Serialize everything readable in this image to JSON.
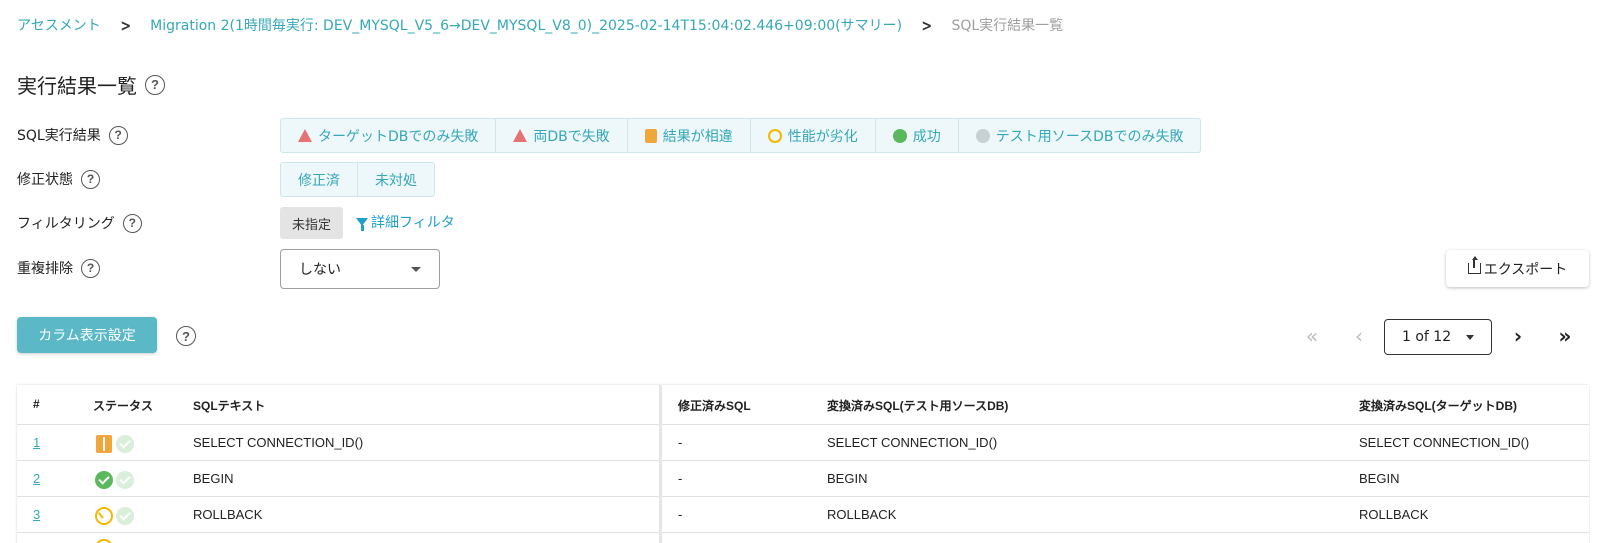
{
  "breadcrumb": {
    "items": [
      "アセスメント",
      "Migration 2(1時間毎実行: DEV_MYSQL_V5_6→DEV_MYSQL_V8_0)_2025-02-14T15:04:02.446+09:00(サマリー)"
    ],
    "current": "SQL実行結果一覧"
  },
  "page_title": "実行結果一覧",
  "filters": {
    "sql_result": {
      "label": "SQL実行結果",
      "options": [
        "ターゲットDBでのみ失敗",
        "両DBで失敗",
        "結果が相違",
        "性能が劣化",
        "成功",
        "テスト用ソースDBでのみ失敗"
      ]
    },
    "fix_status": {
      "label": "修正状態",
      "options": [
        "修正済",
        "未対処"
      ]
    },
    "filtering": {
      "label": "フィルタリング",
      "chip": "未指定",
      "detail_link": "詳細フィルタ"
    },
    "dedup": {
      "label": "重複排除",
      "selected": "しない"
    }
  },
  "export_label": "エクスポート",
  "column_settings_label": "カラム表示設定",
  "pagination": {
    "page_label": "1 of 12"
  },
  "table": {
    "headers": [
      "#",
      "ステータス",
      "SQLテキスト",
      "修正済みSQL",
      "変換済みSQL(テスト用ソースDB)",
      "変換済みSQL(ターゲットDB)"
    ],
    "rows": [
      {
        "num": "1",
        "status": [
          "diff-icon",
          "faint-check-icon"
        ],
        "sql": "SELECT CONNECTION_ID()",
        "fixed": "-",
        "src": "SELECT CONNECTION_ID()",
        "tgt": "SELECT CONNECTION_ID()"
      },
      {
        "num": "2",
        "status": [
          "check-icon",
          "faint-check-icon"
        ],
        "sql": "BEGIN",
        "fixed": "-",
        "src": "BEGIN",
        "tgt": "BEGIN"
      },
      {
        "num": "3",
        "status": [
          "perf-icon",
          "faint-check-icon"
        ],
        "sql": "ROLLBACK",
        "fixed": "-",
        "src": "ROLLBACK",
        "tgt": "ROLLBACK"
      }
    ]
  },
  "colors": {
    "accent": "#35a8b9",
    "link": "#1ea0c8",
    "button": "#5bb8c6",
    "warn": "#e57373",
    "diff": "#f0a63a",
    "perf": "#f5b700",
    "success": "#5cb85c"
  }
}
